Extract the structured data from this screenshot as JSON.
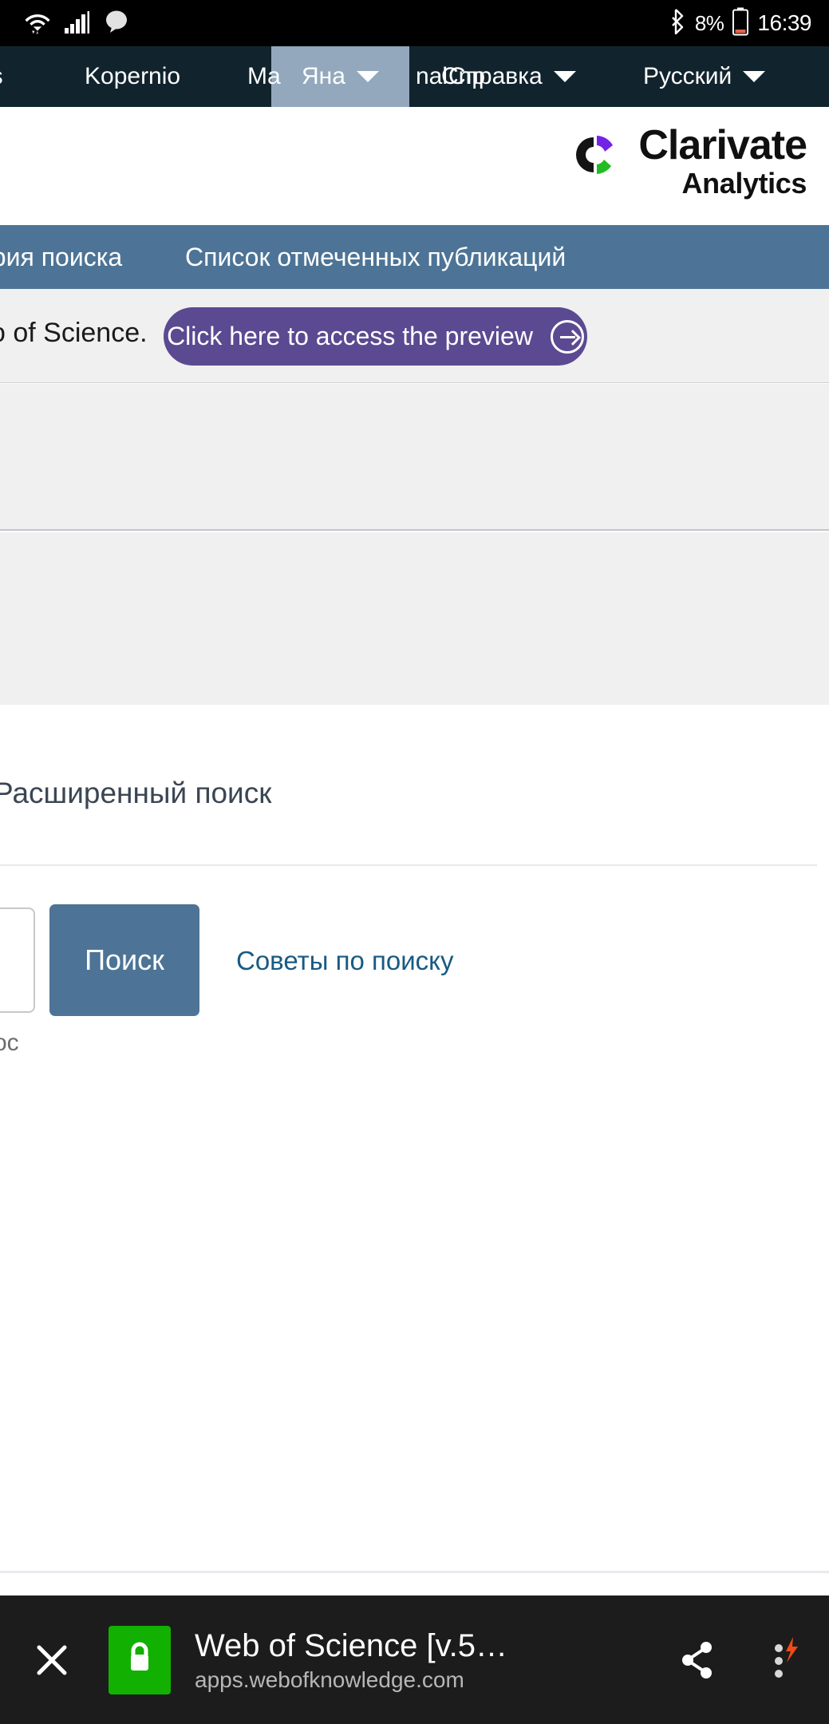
{
  "statusbar": {
    "icons": [
      "wifi-icon",
      "cellular-signal-icon",
      "message-bubble-icon",
      "bluetooth-icon"
    ],
    "battery_percent": "8%",
    "clock": "16:39"
  },
  "sitenav": {
    "items": [
      {
        "label": "ns",
        "caret": false
      },
      {
        "label": "Kopernio",
        "caret": false
      },
      {
        "label": "Ma",
        "caret": false
      },
      {
        "label": "Яна",
        "caret": true
      },
      {
        "label": "nal",
        "caret": false
      },
      {
        "label": "Cnp",
        "caret": false
      },
      {
        "label": "Справка",
        "caret": true
      },
      {
        "label": "Русский",
        "caret": true
      }
    ],
    "highlight_color": "#93a8bd",
    "background": "#11242e"
  },
  "brand": {
    "name": "Clarivate",
    "subtitle": "Analytics",
    "mark_colors": {
      "black": "#1a1a1a",
      "purple": "#7322e8",
      "green": "#22bb22"
    }
  },
  "tabbar": {
    "background": "#4d7496",
    "items": [
      {
        "label": "ория поиска"
      },
      {
        "label": "Список отмеченных публикаций"
      }
    ]
  },
  "preview": {
    "lead_text": "о of Science.",
    "button_label": "Click here to access the preview",
    "button_color": "#5b4a91",
    "arrow_icon": "arrow-right-circle-icon"
  },
  "advanced": {
    "title": "Расширенный поиск"
  },
  "search": {
    "field_value": "",
    "field_placeholder": "",
    "button_label": "Поиск",
    "button_color": "#4d7496",
    "tips_label": "Советы по поиску",
    "tips_color": "#185a82",
    "field_hint": "ос"
  },
  "browserbar": {
    "close_icon": "close-icon",
    "lock_icon": "lock-icon",
    "lock_color": "#12b000",
    "title": "Web of Science [v.5…",
    "url": "apps.webofknowledge.com",
    "share_icon": "share-icon",
    "menu_icon": "more-vertical-icon",
    "badge_icon": "lightning-bolt-icon",
    "badge_color": "#f04b18"
  }
}
